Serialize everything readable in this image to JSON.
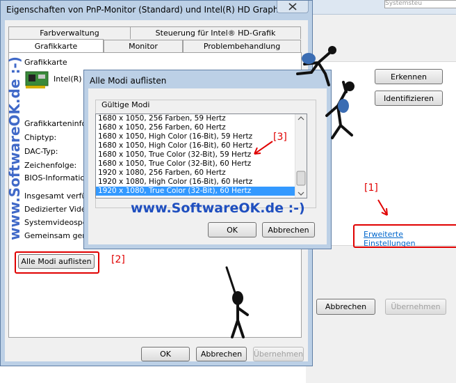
{
  "bg_window": {
    "search_text": "Systemsteu",
    "buttons": {
      "detect": "Erkennen",
      "identify": "Identifizieren",
      "cancel": "Abbrechen",
      "apply": "Übernehmen"
    },
    "advanced_link": "Erweiterte Einstellungen"
  },
  "main_window": {
    "title": "Eigenschaften von PnP-Monitor (Standard) und Intel(R) HD Graphics",
    "tabs_row1": [
      "Farbverwaltung",
      "Steuerung für Intel® HD-Grafik"
    ],
    "tabs_row2": [
      "Grafikkarte",
      "Monitor",
      "Problembehandlung"
    ],
    "group_label": "Grafikkarte",
    "adapter_name": "Intel(R) H",
    "info_labels": [
      "Grafikkarteninform",
      "Chiptyp:",
      "DAC-Typ:",
      "Zeichenfolge:",
      "BIOS-Information"
    ],
    "mem_labels": [
      "Insgesamt verfüg",
      "Dedizierter Videos",
      "Systemvideospeic",
      "Gemeinsam genut"
    ],
    "list_all_button": "Alle Modi auflisten",
    "ok": "OK",
    "cancel": "Abbrechen",
    "apply": "Übernehmen"
  },
  "dialog": {
    "title": "Alle Modi auflisten",
    "group_label": "Gültige Modi",
    "modes": [
      "1680 x 1050, 256 Farben, 59 Hertz",
      "1680 x 1050, 256 Farben, 60 Hertz",
      "1680 x 1050, High Color (16-Bit), 59 Hertz",
      "1680 x 1050, High Color (16-Bit), 60 Hertz",
      "1680 x 1050, True Color (32-Bit), 59 Hertz",
      "1680 x 1050, True Color (32-Bit), 60 Hertz",
      "1920 x 1080, 256 Farben, 60 Hertz",
      "1920 x 1080, High Color (16-Bit), 60 Hertz",
      "1920 x 1080, True Color (32-Bit), 60 Hertz"
    ],
    "selected_index": 8,
    "ok": "OK",
    "cancel": "Abbrechen"
  },
  "annotations": {
    "a1": "[1]",
    "a2": "[2]",
    "a3": "[3]"
  },
  "watermark": {
    "banner": "www.SoftwareOK.de :-)",
    "vertical": "www.SoftwareOK.de :-)"
  },
  "colors": {
    "accent_red": "#e00000",
    "selection": "#3399ff",
    "link": "#0066cc",
    "watermark": "#1f4fbf"
  }
}
